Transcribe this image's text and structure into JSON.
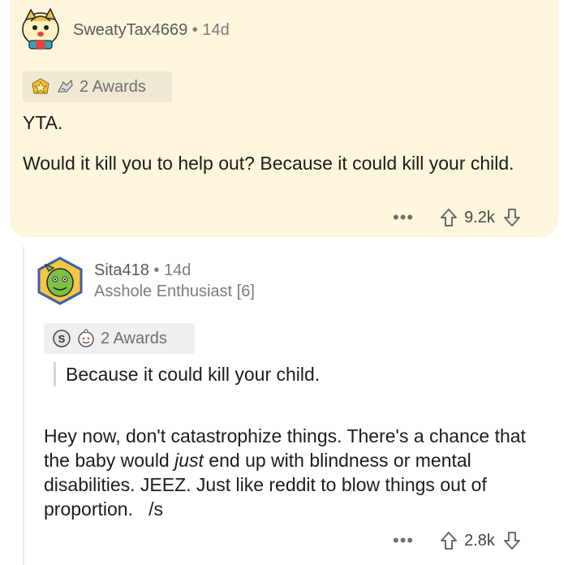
{
  "comment1": {
    "username": "SweatyTax4669",
    "separator": "•",
    "age": "14d",
    "awards_label": "2 Awards",
    "body_line1": "YTA.",
    "body_line2": "Would it kill you to help out? Because it could kill your child.",
    "more": "•••",
    "score": "9.2k"
  },
  "comment2": {
    "username": "Sita418",
    "separator": "•",
    "age": "14d",
    "flair": "Asshole Enthusiast [6]",
    "awards_label": "2 Awards",
    "quote": "Because it could kill your child.",
    "body_before_em": "Hey now, don't catastrophize things. There's a chance that the baby would ",
    "body_em": "just",
    "body_after_em": " end up with blindness or mental disabilities. JEEZ. Just like reddit to blow things out of proportion.   /s",
    "more": "•••",
    "score": "2.8k"
  },
  "colors": {
    "highlight_bg": "#fdf6dc",
    "text": "#1c1c1c",
    "muted": "#7c7c7c"
  },
  "icons": [
    "snoo-avatar-tiger",
    "snoo-avatar-dino",
    "award-star-icon",
    "award-hands-icon",
    "award-silver-icon",
    "award-wholesome-icon",
    "more-icon",
    "upvote-icon",
    "downvote-icon"
  ]
}
